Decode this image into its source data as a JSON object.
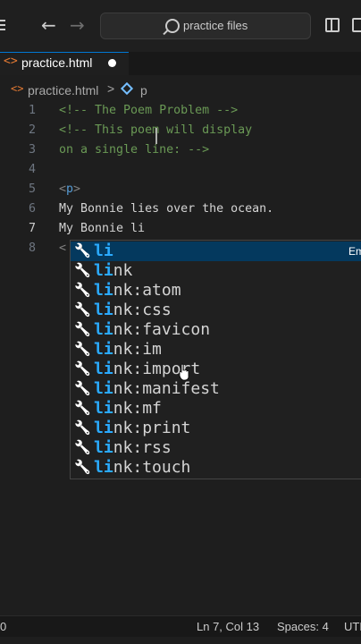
{
  "titlebar": {
    "back_icon": "arrow-left-icon",
    "forward_icon": "arrow-right-icon",
    "search_text": "practice files",
    "search_icon": "search-icon"
  },
  "tab": {
    "label": "practice.html",
    "icon": "html-file-icon",
    "dirty": true
  },
  "breadcrumb": {
    "file": "practice.html",
    "separator": ">",
    "symbol": "p",
    "symbol_icon": "symbol-element-icon"
  },
  "editor": {
    "line_numbers": [
      "1",
      "2",
      "3",
      "4",
      "5",
      "6",
      "7",
      "8"
    ],
    "lines": {
      "l1": "<!-- The Poem Problem -->",
      "l2": "<!-- This poem will display",
      "l3": "on a single line: -->",
      "l5_open": "<",
      "l5_tag": "p",
      "l5_close": ">",
      "l6": "My Bonnie lies over the ocean.",
      "l7": "My Bonnie li",
      "l8": "<"
    },
    "cursor": {
      "line": 7,
      "col": 13
    }
  },
  "suggest": {
    "items": [
      {
        "match": "li",
        "rest": ""
      },
      {
        "match": "li",
        "rest": "nk"
      },
      {
        "match": "li",
        "rest": "nk:atom"
      },
      {
        "match": "li",
        "rest": "nk:css"
      },
      {
        "match": "li",
        "rest": "nk:favicon"
      },
      {
        "match": "li",
        "rest": "nk:im"
      },
      {
        "match": "li",
        "rest": "nk:import"
      },
      {
        "match": "li",
        "rest": "nk:manifest"
      },
      {
        "match": "li",
        "rest": "nk:mf"
      },
      {
        "match": "li",
        "rest": "nk:print"
      },
      {
        "match": "li",
        "rest": "nk:rss"
      },
      {
        "match": "li",
        "rest": "nk:touch"
      }
    ],
    "selected_index": 0,
    "hint": "Em",
    "item_icon": "wrench-icon"
  },
  "statusbar": {
    "left": "0",
    "position": "Ln 7, Col 13",
    "spaces": "Spaces: 4",
    "encoding": "UTF"
  },
  "colors": {
    "comment": "#6a9955",
    "tag": "#569cd6",
    "match_highlight": "#2aaaff",
    "selected_row": "#04395e"
  }
}
